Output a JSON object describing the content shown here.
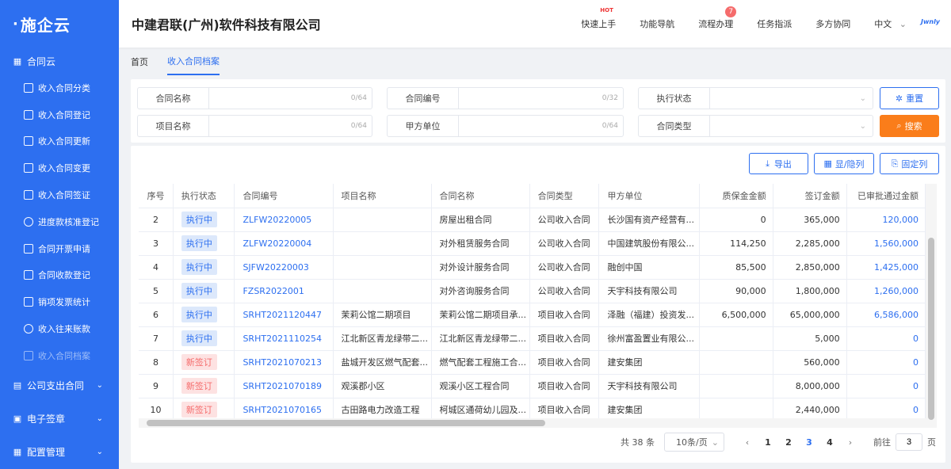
{
  "logo": {
    "text": "施企云"
  },
  "sidebar": {
    "groups": [
      {
        "label": "合同云"
      },
      {
        "label": "公司支出合同"
      },
      {
        "label": "电子签章"
      },
      {
        "label": "配置管理"
      }
    ],
    "items": [
      {
        "label": "收入合同分类"
      },
      {
        "label": "收入合同登记"
      },
      {
        "label": "收入合同更新"
      },
      {
        "label": "收入合同变更"
      },
      {
        "label": "收入合同签证"
      },
      {
        "label": "进度款核准登记"
      },
      {
        "label": "合同开票申请"
      },
      {
        "label": "合同收款登记"
      },
      {
        "label": "销项发票统计"
      },
      {
        "label": "收入往来账款"
      },
      {
        "label": "收入合同档案"
      }
    ]
  },
  "header": {
    "company": "中建君联(广州)软件科技有限公司",
    "nav": {
      "quick_start": "快速上手",
      "quick_start_tag": "HOT",
      "func_nav": "功能导航",
      "process": "流程办理",
      "process_badge": "7",
      "tasks": "任务指派",
      "collab": "多方协同",
      "language": "中文",
      "brand": "Jwnly"
    }
  },
  "tabs": [
    {
      "label": "首页"
    },
    {
      "label": "收入合同档案"
    }
  ],
  "filters": {
    "contract_name": {
      "label": "合同名称",
      "counter": "0/64"
    },
    "contract_no": {
      "label": "合同编号",
      "counter": "0/32"
    },
    "exec_status": {
      "label": "执行状态"
    },
    "project_name": {
      "label": "项目名称",
      "counter": "0/64"
    },
    "party_a": {
      "label": "甲方单位",
      "counter": "0/64"
    },
    "contract_type": {
      "label": "合同类型"
    },
    "reset_label": "重置",
    "search_label": "搜索"
  },
  "toolbar": {
    "export_label": "导出",
    "toggle_cols_label": "显/隐列",
    "fix_cols_label": "固定列"
  },
  "table": {
    "headers": [
      "序号",
      "执行状态",
      "合同编号",
      "项目名称",
      "合同名称",
      "合同类型",
      "甲方单位",
      "质保金金额",
      "签订金额",
      "已审批通过金额"
    ],
    "rows": [
      {
        "no": "2",
        "status": "执行中",
        "status_type": "run",
        "code": "ZLFW20220005",
        "project": "",
        "name": "房屋出租合同",
        "type": "公司收入合同",
        "party": "长沙国有资产经营有...",
        "retention": "0",
        "signed": "365,000",
        "approved": "120,000"
      },
      {
        "no": "3",
        "status": "执行中",
        "status_type": "run",
        "code": "ZLFW20220004",
        "project": "",
        "name": "对外租赁服务合同",
        "type": "公司收入合同",
        "party": "中国建筑股份有限公...",
        "retention": "114,250",
        "signed": "2,285,000",
        "approved": "1,560,000"
      },
      {
        "no": "4",
        "status": "执行中",
        "status_type": "run",
        "code": "SJFW20220003",
        "project": "",
        "name": "对外设计服务合同",
        "type": "公司收入合同",
        "party": "融创中国",
        "retention": "85,500",
        "signed": "2,850,000",
        "approved": "1,425,000"
      },
      {
        "no": "5",
        "status": "执行中",
        "status_type": "run",
        "code": "FZSR2022001",
        "project": "",
        "name": "对外咨询服务合同",
        "type": "公司收入合同",
        "party": "天宇科技有限公司",
        "retention": "90,000",
        "signed": "1,800,000",
        "approved": "1,260,000"
      },
      {
        "no": "6",
        "status": "执行中",
        "status_type": "run",
        "code": "SRHT2021120447",
        "project": "茉莉公馆二期项目",
        "name": "茉莉公馆二期项目承...",
        "type": "项目收入合同",
        "party": "泽融（福建）投资发...",
        "retention": "6,500,000",
        "signed": "65,000,000",
        "approved": "6,586,000"
      },
      {
        "no": "7",
        "status": "执行中",
        "status_type": "run",
        "code": "SRHT2021110254",
        "project": "江北新区青龙绿带二...",
        "name": "江北新区青龙绿带二...",
        "type": "项目收入合同",
        "party": "徐州富盈置业有限公...",
        "retention": "",
        "signed": "5,000",
        "approved": "0"
      },
      {
        "no": "8",
        "status": "新签订",
        "status_type": "new",
        "code": "SRHT2021070213",
        "project": "盐城开发区燃气配套...",
        "name": "燃气配套工程施工合...",
        "type": "项目收入合同",
        "party": "建安集团",
        "retention": "",
        "signed": "560,000",
        "approved": "0"
      },
      {
        "no": "9",
        "status": "新签订",
        "status_type": "new",
        "code": "SRHT2021070189",
        "project": "观溪郡小区",
        "name": "观溪小区工程合同",
        "type": "项目收入合同",
        "party": "天宇科技有限公司",
        "retention": "",
        "signed": "8,000,000",
        "approved": "0"
      },
      {
        "no": "10",
        "status": "新签订",
        "status_type": "new",
        "code": "SRHT2021070165",
        "project": "古田路电力改造工程",
        "name": "柯城区通荷幼儿园及...",
        "type": "项目收入合同",
        "party": "建安集团",
        "retention": "",
        "signed": "2,440,000",
        "approved": "0"
      }
    ]
  },
  "pagination": {
    "total": "共 38 条",
    "page_size": "10条/页",
    "pages": [
      "1",
      "2",
      "3",
      "4"
    ],
    "current_page": "3",
    "goto_prefix": "前往",
    "goto_value": "3",
    "goto_suffix": "页"
  },
  "colors": {
    "primary": "#2d6ff0",
    "accent": "#fa7d1a",
    "running_bg": "#dce8fb",
    "new_bg": "#fde2e2",
    "new_text": "#f56c6c"
  }
}
